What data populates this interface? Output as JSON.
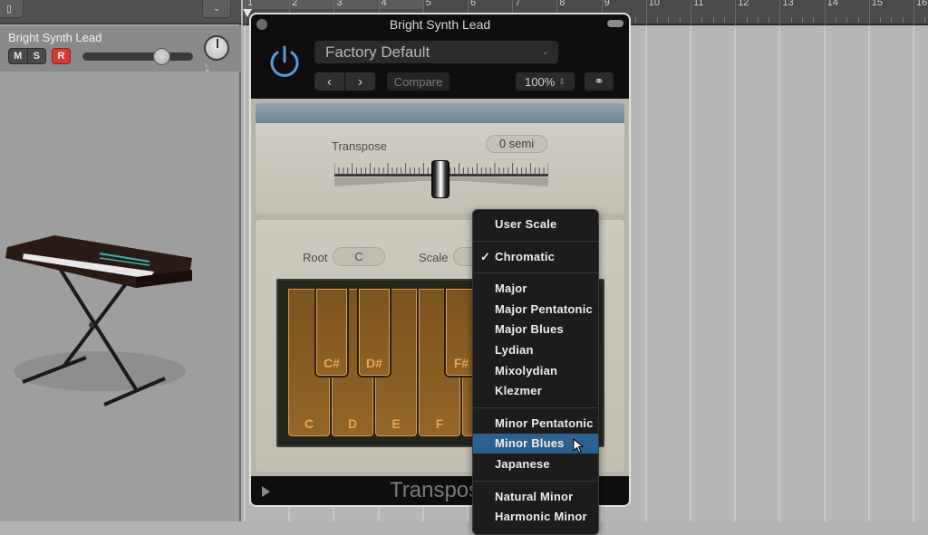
{
  "inspector": {
    "track_name": "Bright Synth Lead",
    "mute_label": "M",
    "solo_label": "S",
    "record_label": "R",
    "volume_level": 0.72,
    "pan_labels": "L R",
    "instrument_image": "synthesizer-on-x-stand"
  },
  "ruler": {
    "bars": [
      "1",
      "2",
      "3",
      "4",
      "5",
      "6",
      "7",
      "8",
      "9",
      "10",
      "11",
      "12",
      "13",
      "14",
      "15",
      "16"
    ]
  },
  "plugin": {
    "title": "Bright Synth Lead",
    "preset": "Factory Default",
    "prev_label": "‹",
    "next_label": "›",
    "compare_label": "Compare",
    "zoom": "100%",
    "footer_title": "Transpose",
    "transpose": {
      "label": "Transpose",
      "value": "0 semi",
      "semitones": 0
    },
    "root": {
      "label": "Root",
      "value": "C"
    },
    "scale": {
      "label": "Scale"
    },
    "keys": {
      "white": [
        "C",
        "D",
        "E",
        "F"
      ],
      "black": [
        "C#",
        "D#",
        "F#"
      ]
    }
  },
  "scale_menu": {
    "selected_check": "Chromatic",
    "highlighted": "Minor Blues",
    "check_glyph": "✓",
    "groups": [
      [
        "User Scale"
      ],
      [
        "Chromatic"
      ],
      [
        "Major",
        "Major Pentatonic",
        "Major Blues",
        "Lydian",
        "Mixolydian",
        "Klezmer"
      ],
      [
        "Minor Pentatonic",
        "Minor Blues",
        "Japanese"
      ],
      [
        "Natural Minor",
        "Harmonic Minor"
      ]
    ]
  }
}
